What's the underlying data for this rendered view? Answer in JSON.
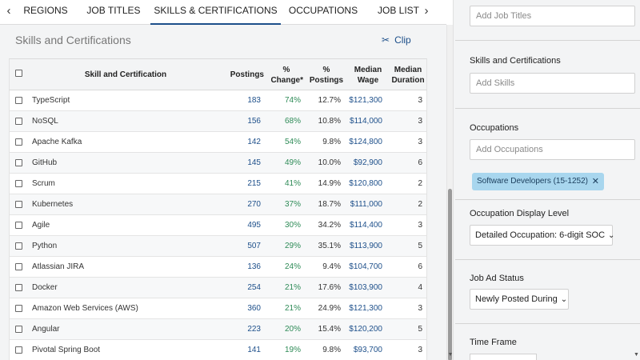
{
  "tabs": {
    "prev_icon": "chevron-left-icon",
    "next_icon": "chevron-right-icon",
    "items": [
      {
        "label": "REGIONS"
      },
      {
        "label": "JOB TITLES"
      },
      {
        "label": "SKILLS & CERTIFICATIONS"
      },
      {
        "label": "OCCUPATIONS"
      },
      {
        "label": "JOB LIST"
      }
    ],
    "active_index": 2
  },
  "section": {
    "title": "Skills and Certifications",
    "clip_label": "Clip",
    "clip_icon": "scissors-icon"
  },
  "table": {
    "headers": {
      "skill": "Skill and Certification",
      "postings": "Postings",
      "change_line1": "%",
      "change_line2": "Change*",
      "pct_line1": "%",
      "pct_line2": "Postings",
      "wage_line1": "Median",
      "wage_line2": "Wage",
      "dur_line1": "Median",
      "dur_line2": "Duration"
    },
    "rows": [
      {
        "name": "TypeScript",
        "postings": "183",
        "change": "74%",
        "pct": "12.7%",
        "wage": "$121,300",
        "duration": "3"
      },
      {
        "name": "NoSQL",
        "postings": "156",
        "change": "68%",
        "pct": "10.8%",
        "wage": "$114,000",
        "duration": "3"
      },
      {
        "name": "Apache Kafka",
        "postings": "142",
        "change": "54%",
        "pct": "9.8%",
        "wage": "$124,800",
        "duration": "3"
      },
      {
        "name": "GitHub",
        "postings": "145",
        "change": "49%",
        "pct": "10.0%",
        "wage": "$92,900",
        "duration": "6"
      },
      {
        "name": "Scrum",
        "postings": "215",
        "change": "41%",
        "pct": "14.9%",
        "wage": "$120,800",
        "duration": "2"
      },
      {
        "name": "Kubernetes",
        "postings": "270",
        "change": "37%",
        "pct": "18.7%",
        "wage": "$111,000",
        "duration": "2"
      },
      {
        "name": "Agile",
        "postings": "495",
        "change": "30%",
        "pct": "34.2%",
        "wage": "$114,400",
        "duration": "3"
      },
      {
        "name": "Python",
        "postings": "507",
        "change": "29%",
        "pct": "35.1%",
        "wage": "$113,900",
        "duration": "5"
      },
      {
        "name": "Atlassian JIRA",
        "postings": "136",
        "change": "24%",
        "pct": "9.4%",
        "wage": "$104,700",
        "duration": "6"
      },
      {
        "name": "Docker",
        "postings": "254",
        "change": "21%",
        "pct": "17.6%",
        "wage": "$103,900",
        "duration": "4"
      },
      {
        "name": "Amazon Web Services (AWS)",
        "postings": "360",
        "change": "21%",
        "pct": "24.9%",
        "wage": "$121,300",
        "duration": "3"
      },
      {
        "name": "Angular",
        "postings": "223",
        "change": "20%",
        "pct": "15.4%",
        "wage": "$120,200",
        "duration": "5"
      },
      {
        "name": "Pivotal Spring Boot",
        "postings": "141",
        "change": "19%",
        "pct": "9.8%",
        "wage": "$93,700",
        "duration": "3"
      }
    ]
  },
  "filters": {
    "job_titles": {
      "placeholder": "Add Job Titles"
    },
    "skills": {
      "label": "Skills and Certifications",
      "placeholder": "Add Skills"
    },
    "occupations": {
      "label": "Occupations",
      "placeholder": "Add Occupations",
      "chip": "Software Developers (15-1252)",
      "chip_remove_icon": "close-icon"
    },
    "display_level": {
      "label": "Occupation Display Level",
      "value": "Detailed Occupation: 6-digit SOC"
    },
    "job_ad_status": {
      "label": "Job Ad Status",
      "value": "Newly Posted During"
    },
    "time_frame": {
      "label": "Time Frame"
    }
  },
  "colors": {
    "accent": "#1d4f8a",
    "positive_change": "#2e8b57",
    "chip_bg": "#a8d6ee"
  }
}
